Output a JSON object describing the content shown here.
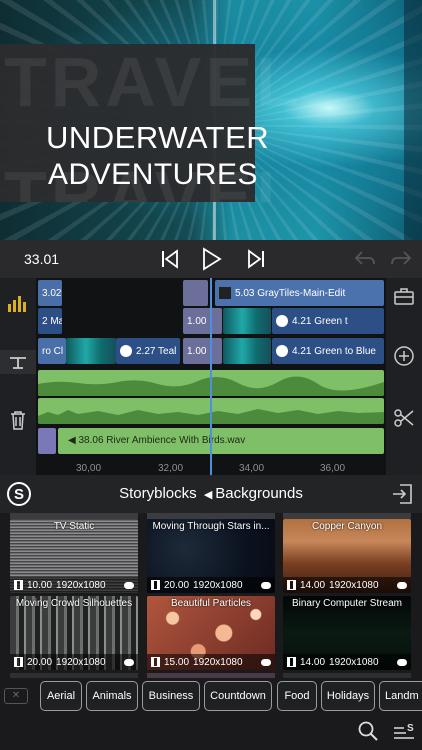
{
  "preview": {
    "ghost_word_top": "TRAVEL",
    "ghost_word_bottom": "TRAVEL",
    "title_line1": "UNDERWATER",
    "title_line2": "ADVENTURES"
  },
  "transport": {
    "timecode": "33.01",
    "icons": [
      "skip-back-icon",
      "play-icon",
      "skip-forward-icon",
      "undo-icon",
      "redo-icon"
    ]
  },
  "timeline": {
    "left_tools": [
      "audio-levels-icon",
      "mic-stand-icon",
      "trash-icon"
    ],
    "right_tools": [
      "toolbox-icon",
      "add-icon",
      "scissors-icon"
    ],
    "clips": {
      "t1_a": "3.02",
      "t1_b": "5.03  GrayTiles-Main-Edit",
      "t2_a": "2  Ma",
      "t2_b": "1.00",
      "t2_c": "4.21   Green t",
      "t3_a": "ro Cl",
      "t3_b": "2.27   Teal",
      "t3_c": "1.00",
      "t3_d": "4.21   Green to Blue",
      "audio_label": "38.06   River Ambience With Birds.wav"
    },
    "ruler": [
      "30,00",
      "32,00",
      "34,00",
      "36,00"
    ]
  },
  "library": {
    "source": "Storyblocks",
    "category": "Backgrounds",
    "tiles": [
      {
        "name": "TV Static",
        "duration": "10.00",
        "resolution": "1920x1080"
      },
      {
        "name": "Moving Through Stars in...",
        "duration": "20.00",
        "resolution": "1920x1080"
      },
      {
        "name": "Copper Canyon",
        "duration": "14.00",
        "resolution": "1920x1080"
      },
      {
        "name": "Moving Crowd Silhouettes",
        "duration": "20.00",
        "resolution": "1920x1080"
      },
      {
        "name": "Beautiful Particles",
        "duration": "15.00",
        "resolution": "1920x1080"
      },
      {
        "name": "Binary Computer Stream",
        "duration": "14.00",
        "resolution": "1920x1080"
      }
    ]
  },
  "categories": {
    "clear_label": "✕",
    "chips": [
      "Aerial",
      "Animals",
      "Business",
      "Countdown",
      "Food",
      "Holidays",
      "Landm"
    ]
  },
  "colors": {
    "accent_blue": "#4e8fde",
    "clip_blue": "#4a6fa8",
    "audio_green": "#7fbf67"
  }
}
